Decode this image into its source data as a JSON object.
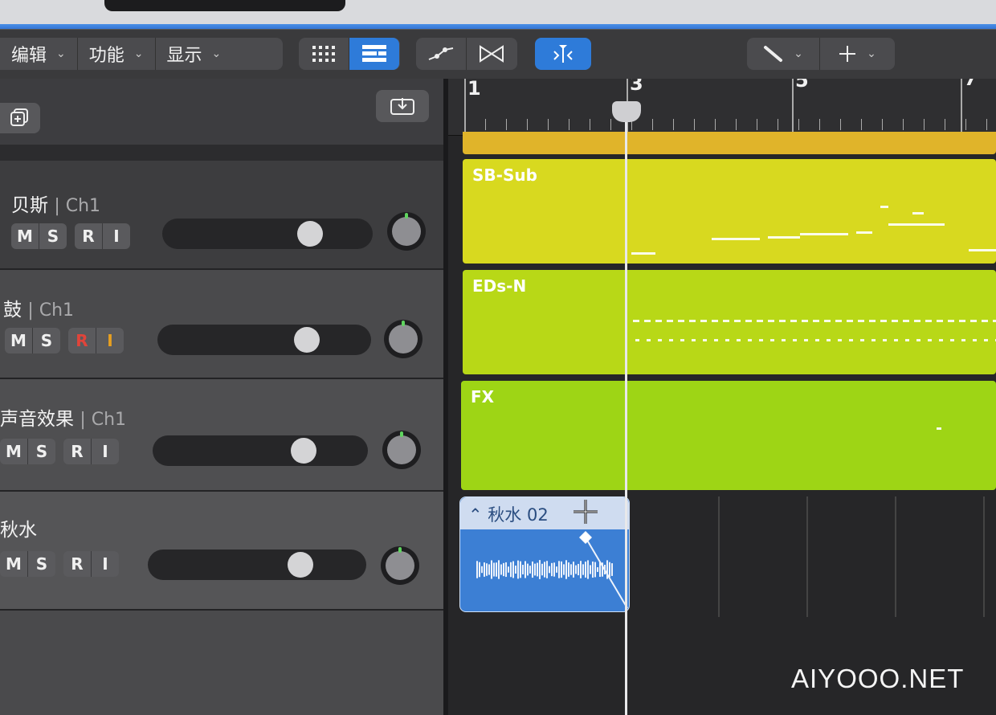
{
  "toolbar": {
    "menu_edit": "编辑",
    "menu_function": "功能",
    "menu_display": "显示"
  },
  "tracks": [
    {
      "name": "贝斯",
      "channel": "| Ch1"
    },
    {
      "name": "鼓",
      "channel": "| Ch1"
    },
    {
      "name": "声音效果",
      "channel": "| Ch1"
    },
    {
      "name": "秋水",
      "channel": ""
    }
  ],
  "track_buttons": {
    "mute": "M",
    "solo": "S",
    "record": "R",
    "input": "I"
  },
  "ruler": {
    "bars": [
      "1",
      "3",
      "5",
      "7"
    ]
  },
  "regions": [
    {
      "name": "SB-Sub",
      "color": "#d8d91f"
    },
    {
      "name": "EDs-N",
      "color": "#b8d817"
    },
    {
      "name": "FX",
      "color": "#9ed515"
    }
  ],
  "audio_region": {
    "name": "秋水 02",
    "color": "#3c7fd4"
  },
  "watermark": "AIYOOO.NET",
  "colors": {
    "accent": "#2e7bd9",
    "record_red": "#e0443a",
    "input_orange": "#e8a020"
  }
}
